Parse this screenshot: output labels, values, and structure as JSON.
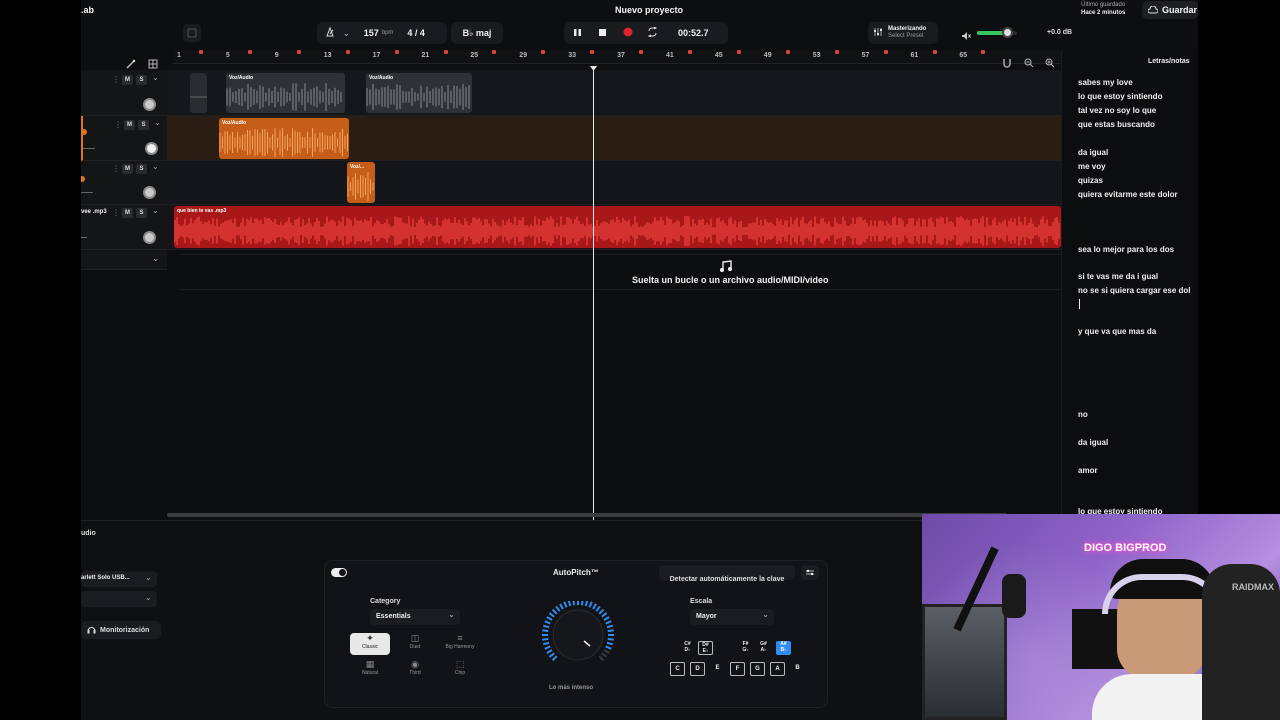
{
  "app": {
    "partial_logo": ".ab",
    "project_title": "Nuevo proyecto",
    "save_status_line1": "Último guardado",
    "save_status_line2": "Hace 2 minutos",
    "save_label": "Guardar"
  },
  "transport": {
    "bpm": "157",
    "bpm_unit": "bpm",
    "time_signature": "4 / 4",
    "key": "B♭ maj",
    "time": "00:52.7"
  },
  "mastering": {
    "title": "Masterizando",
    "preset": "Select Preset",
    "volume_db": "+0.0 dB"
  },
  "ruler": {
    "marks": [
      "1",
      "5",
      "9",
      "13",
      "17",
      "21",
      "25",
      "29",
      "33",
      "37",
      "41",
      "45",
      "49",
      "53",
      "57",
      "61",
      "65"
    ]
  },
  "tracks": [
    {
      "clips": [
        {
          "label": ""
        },
        {
          "label": "Voz/Audio"
        },
        {
          "label": "Voz/Audio"
        }
      ]
    },
    {
      "clips": [
        {
          "label": "Voz/Audio"
        }
      ]
    },
    {
      "clips": [
        {
          "label": "Voz/..."
        }
      ]
    },
    {
      "head_label": "vee .mp3",
      "clips": [
        {
          "label": "que bien te vas .mp3"
        }
      ]
    }
  ],
  "track_buttons": {
    "mute": "M",
    "solo": "S"
  },
  "drop_zone": {
    "text": "Suelta un bucle o un archivo audio/MIDI/video"
  },
  "lyrics": {
    "title": "Letras/notas",
    "lines": [
      "sabes my love",
      "lo que estoy  sintiendo",
      "tal vez no soy lo que",
      " que estas buscando",
      "da igual",
      "me voy",
      "quizas",
      "quiera evitarme este dolor",
      "sea lo mejor para los dos",
      "si te vas me da i gual",
      "  no se si quiera cargar ese dol",
      "y que va que mas da",
      "no",
      "da igual",
      "amor",
      "lo que estoy sintiendo"
    ]
  },
  "bottom": {
    "section_label": "udio",
    "device": "arlett Solo USB...",
    "monitor_label": "Monitorización"
  },
  "autopitch": {
    "title": "AutoPitch™",
    "detect_label": "Detectar automáticamente la clave",
    "category_label": "Category",
    "category_value": "Essentials",
    "modes": [
      "Classic",
      "Duet",
      "Big Harmony",
      "Natural",
      "Third",
      "Chip"
    ],
    "knob_label": "Lo más intenso",
    "scale_label": "Escala",
    "scale_value": "Mayor",
    "sharp_keys": [
      "C#\nD♭",
      "D#\nE♭",
      "F#\nG♭",
      "G#\nA♭",
      "A#\nB♭"
    ],
    "natural_keys": [
      "C",
      "D",
      "E",
      "F",
      "G",
      "A",
      "B"
    ]
  },
  "webcam": {
    "neon_sign": "DIGO BIGPROD",
    "chair_brand": "RAIDMAX"
  },
  "colors": {
    "accent_orange": "#e0741e",
    "clip_red": "#d42020",
    "record_red": "#e0242c",
    "volume_green": "#36c25c",
    "key_active_blue": "#2f8cf0"
  }
}
